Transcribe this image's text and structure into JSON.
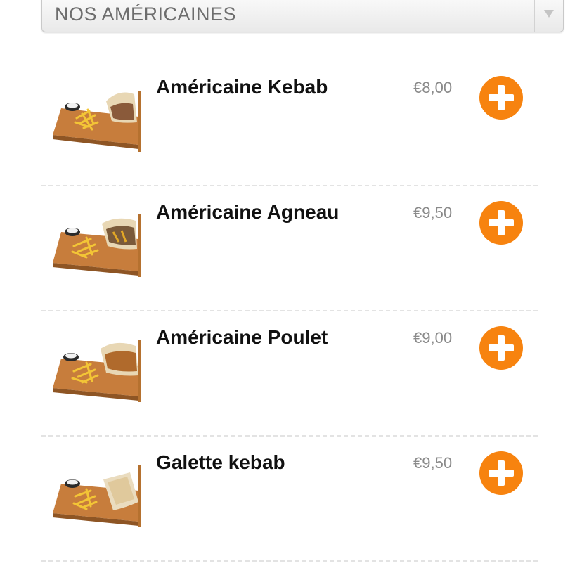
{
  "category": {
    "label": "NOS AMÉRICAINES",
    "arrow_icon": "triangle-down-icon"
  },
  "colors": {
    "accent": "#f7830f",
    "price": "#8a8a8a",
    "divider": "#e3e3e3"
  },
  "items": [
    {
      "name": "Américaine Kebab",
      "price": "€8,00",
      "image": "kebab-sandwich-fries-plate",
      "add_icon": "plus-circle-icon"
    },
    {
      "name": "Américaine Agneau",
      "price": "€9,50",
      "image": "lamb-sandwich-fries-plate",
      "add_icon": "plus-circle-icon"
    },
    {
      "name": "Américaine Poulet",
      "price": "€9,00",
      "image": "chicken-sandwich-fries-plate",
      "add_icon": "plus-circle-icon"
    },
    {
      "name": "Galette kebab",
      "price": "€9,50",
      "image": "galette-fries-plate",
      "add_icon": "plus-circle-icon"
    }
  ]
}
